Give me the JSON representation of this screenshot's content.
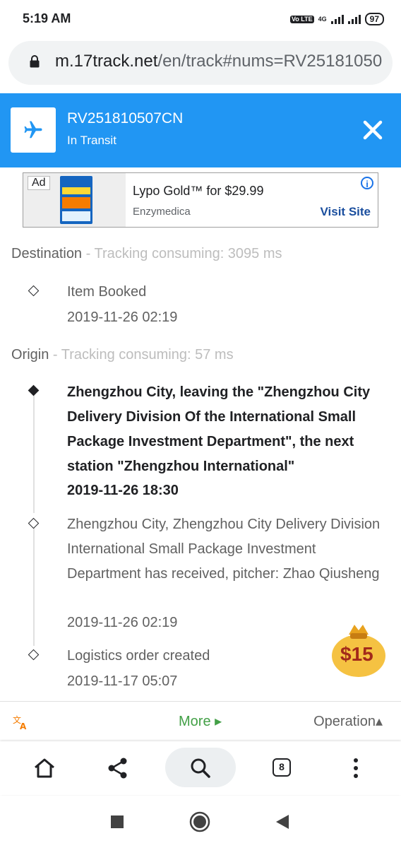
{
  "status_bar": {
    "time": "5:19 AM",
    "volte": "Vo LTE",
    "network": "4G",
    "battery": "97"
  },
  "url_bar": {
    "host": "m.17track.net",
    "path": "/en/track#nums=RV25181050"
  },
  "header": {
    "tracking_number": "RV251810507CN",
    "status": "In Transit",
    "accent_color": "#2196f3",
    "icon": "airplane-icon"
  },
  "ad": {
    "badge": "Ad",
    "title": "Lypo Gold™ for $29.99",
    "advertiser": "Enzymedica",
    "cta": "Visit Site",
    "info_glyph": "i"
  },
  "destination": {
    "label": "Destination",
    "timing": " - Tracking consuming: 3095 ms",
    "events": [
      {
        "text": "Item Booked",
        "time": "2019-11-26 02:19"
      }
    ]
  },
  "origin": {
    "label": "Origin",
    "timing": " - Tracking consuming: 57 ms",
    "events": [
      {
        "text": "Zhengzhou City, leaving the \"Zhengzhou City Delivery Division Of the International Small Package Investment Department\", the next station \"Zhengzhou International\"",
        "time": "2019-11-26 18:30"
      },
      {
        "text": "Zhengzhou City, Zhengzhou City Delivery Division International Small Package Investment Department has received, pitcher: Zhao Qiusheng",
        "time": "2019-11-26 02:19"
      },
      {
        "text": "Logistics order created",
        "time": "2019-11-17 05:07"
      }
    ]
  },
  "coupon": {
    "label": "$15"
  },
  "operation_bar": {
    "more_label": "More ▸",
    "operation_label": "Operation▴"
  },
  "browser_bar": {
    "tab_count": "8"
  }
}
